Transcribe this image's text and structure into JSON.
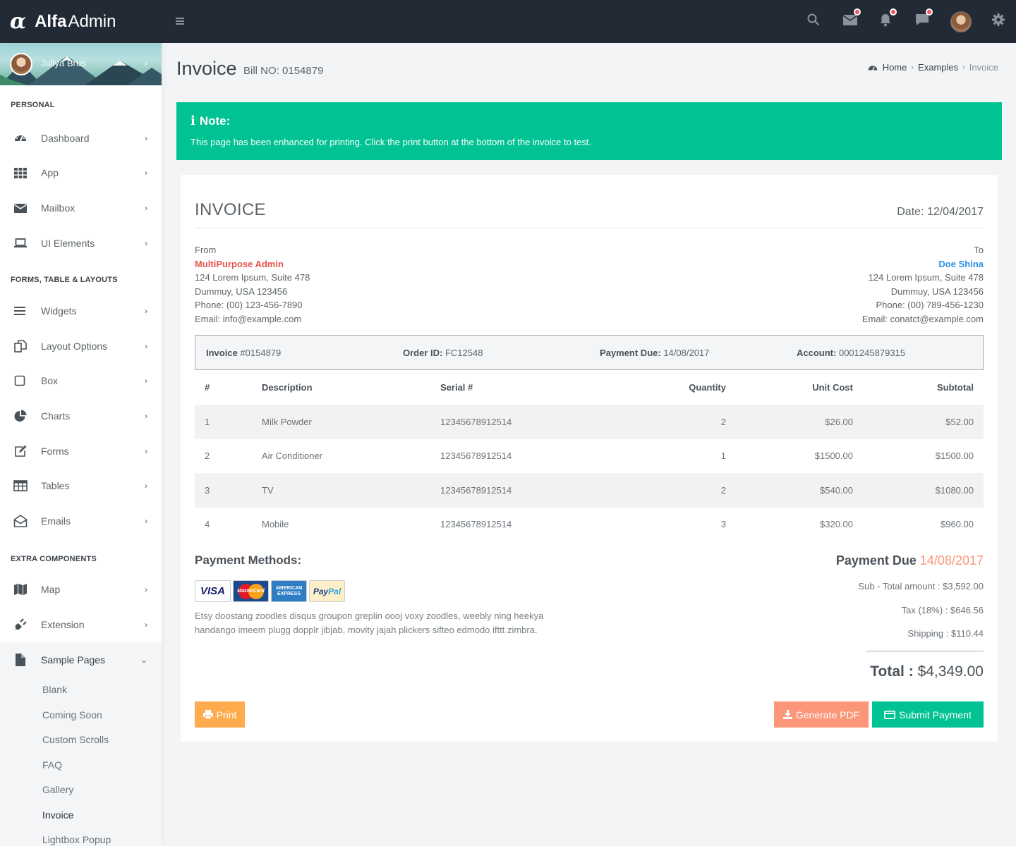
{
  "brand": {
    "part1": "Alfa",
    "part2": "Admin"
  },
  "colors": {
    "topbar": "#222a35",
    "accent_green": "#00c292",
    "accent_orange": "#fdab4d",
    "accent_salmon": "#fb9678",
    "from_red": "#e8544e",
    "to_blue": "#2c8fe3"
  },
  "topbar": {
    "icons": [
      "menu-icon",
      "search-icon",
      "mail-icon",
      "bell-icon",
      "chat-icon",
      "avatar",
      "gear-icon"
    ]
  },
  "sidebar": {
    "user_name": "Juliya Brus",
    "section_personal": "PERSONAL",
    "section_forms": "FORMS, TABLE & LAYOUTS",
    "section_extra": "EXTRA COMPONENTS",
    "personal": [
      {
        "label": "Dashboard",
        "icon": "dashboard-icon"
      },
      {
        "label": "App",
        "icon": "grid-icon"
      },
      {
        "label": "Mailbox",
        "icon": "envelope-icon"
      },
      {
        "label": "UI Elements",
        "icon": "laptop-icon"
      }
    ],
    "forms": [
      {
        "label": "Widgets",
        "icon": "bars-icon"
      },
      {
        "label": "Layout Options",
        "icon": "copy-icon"
      },
      {
        "label": "Box",
        "icon": "square-icon"
      },
      {
        "label": "Charts",
        "icon": "pie-chart-icon"
      },
      {
        "label": "Forms",
        "icon": "edit-icon"
      },
      {
        "label": "Tables",
        "icon": "table-icon"
      },
      {
        "label": "Emails",
        "icon": "envelope-open-icon"
      }
    ],
    "extra": [
      {
        "label": "Map",
        "icon": "map-icon"
      },
      {
        "label": "Extension",
        "icon": "plug-icon"
      },
      {
        "label": "Sample Pages",
        "icon": "file-icon"
      }
    ],
    "sample_pages": [
      "Blank",
      "Coming Soon",
      "Custom Scrolls",
      "FAQ",
      "Gallery",
      "Invoice",
      "Lightbox Popup"
    ]
  },
  "header": {
    "title": "Invoice",
    "subtitle": "Bill NO: 0154879",
    "breadcrumb": [
      "Home",
      "Examples",
      "Invoice"
    ]
  },
  "note": {
    "title": "Note:",
    "text": "This page has been enhanced for printing. Click the print button at the bottom of the invoice to test."
  },
  "invoice": {
    "heading": "INVOICE",
    "date": "Date: 12/04/2017",
    "from": {
      "label": "From",
      "name": "MultiPurpose Admin",
      "address1": "124 Lorem Ipsum, Suite 478",
      "address2": "Dummuy, USA 123456",
      "phone": "Phone: (00) 123-456-7890",
      "email": "Email: info@example.com"
    },
    "to": {
      "label": "To",
      "name": "Doe Shina",
      "address1": "124 Lorem Ipsum, Suite 478",
      "address2": "Dummuy, USA 123456",
      "phone": "Phone: (00) 789-456-1230",
      "email": "Email: conatct@example.com"
    },
    "meta": {
      "invoice_label": "Invoice",
      "invoice_value": "#0154879",
      "order_label": "Order ID:",
      "order_value": "FC12548",
      "due_label": "Payment Due:",
      "due_value": "14/08/2017",
      "account_label": "Account:",
      "account_value": "0001245879315"
    },
    "columns": [
      "#",
      "Description",
      "Serial #",
      "Quantity",
      "Unit Cost",
      "Subtotal"
    ],
    "rows": [
      {
        "num": "1",
        "desc": "Milk Powder",
        "serial": "12345678912514",
        "qty": "2",
        "unit": "$26.00",
        "sub": "$52.00"
      },
      {
        "num": "2",
        "desc": "Air Conditioner",
        "serial": "12345678912514",
        "qty": "1",
        "unit": "$1500.00",
        "sub": "$1500.00"
      },
      {
        "num": "3",
        "desc": "TV",
        "serial": "12345678912514",
        "qty": "2",
        "unit": "$540.00",
        "sub": "$1080.00"
      },
      {
        "num": "4",
        "desc": "Mobile",
        "serial": "12345678912514",
        "qty": "3",
        "unit": "$320.00",
        "sub": "$960.00"
      }
    ],
    "payment_methods_title": "Payment Methods:",
    "payment_cards": {
      "visa": "VISA",
      "mastercard": "MasterCard",
      "amex1": "AMERICAN",
      "amex2": "EXPRESS",
      "paypal1": "Pay",
      "paypal2": "Pal"
    },
    "payment_text": "Etsy doostang zoodles disqus groupon greplin oooj voxy zoodles, weebly ning heekya handango imeem plugg dopplr jibjab, movity jajah plickers sifteo edmodo ifttt zimbra.",
    "due_label": "Payment Due",
    "due_date": "14/08/2017",
    "subtotal": "Sub - Total amount : $3,592.00",
    "tax": "Tax (18%) : $646.56",
    "shipping": "Shipping : $110.44",
    "total_label": "Total :",
    "total_value": "$4,349.00",
    "btn_print": "Print",
    "btn_pdf": "Generate PDF",
    "btn_submit": "Submit Payment"
  }
}
